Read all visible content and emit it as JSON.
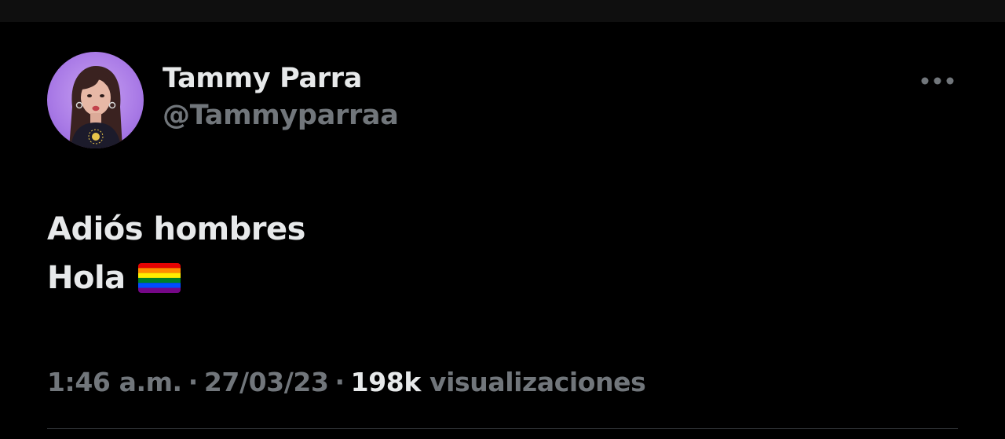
{
  "tweet": {
    "author": {
      "display_name": "Tammy Parra",
      "handle": "@Tammyparraa",
      "avatar": "profile-photo"
    },
    "text_lines": [
      "Adiós hombres",
      "Hola"
    ],
    "emoji": "rainbow-flag",
    "time": "1:46 a.m.",
    "date": "27/03/23",
    "separator": "·",
    "views_count": "198k",
    "views_label": "visualizaciones",
    "more_icon": "more-horizontal-icon"
  },
  "colors": {
    "background": "#000000",
    "text_primary": "#e7e9ea",
    "text_secondary": "#71767b",
    "divider": "#2f3336",
    "avatar_bg": "#a97ae6"
  }
}
